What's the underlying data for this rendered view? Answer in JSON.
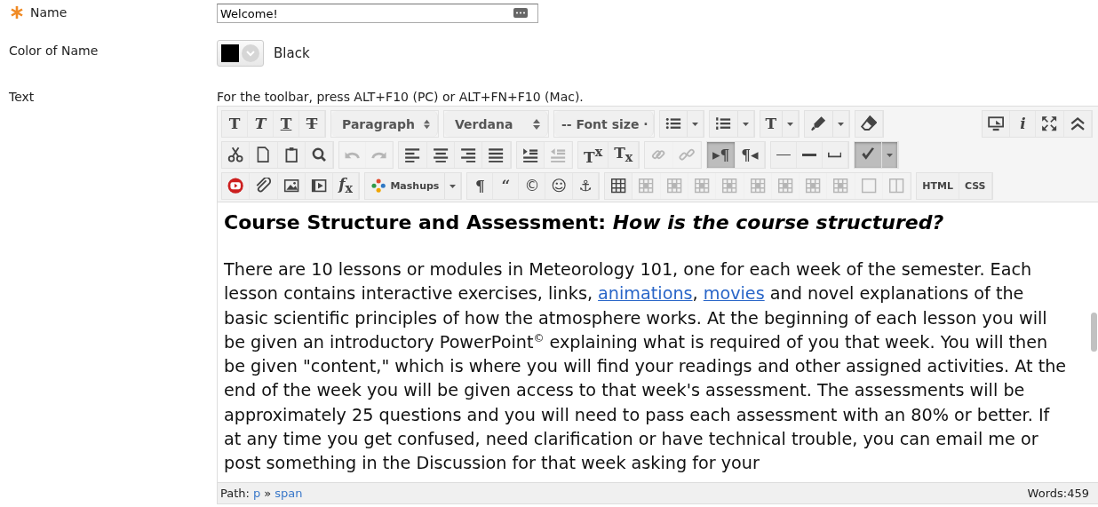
{
  "fields": {
    "name": {
      "label": "Name",
      "required": true,
      "value": "Welcome!"
    },
    "color": {
      "label": "Color of Name",
      "value": "Black"
    },
    "text": {
      "label": "Text",
      "hint": "For the toolbar, press ALT+F10 (PC) or ALT+FN+F10 (Mac)."
    }
  },
  "toolbar": {
    "rows": [
      {
        "groups": [
          {
            "items": [
              {
                "kind": "text",
                "label": "T",
                "disabled": false,
                "pressed": false
              },
              {
                "kind": "text",
                "label": "T",
                "disabled": false,
                "pressed": false
              },
              {
                "kind": "text",
                "label": "T",
                "disabled": false,
                "pressed": false
              },
              {
                "kind": "text",
                "label": "T",
                "disabled": false,
                "pressed": false
              }
            ]
          },
          {
            "items": [
              {
                "kind": "select",
                "label": "Paragraph",
                "disabled": false,
                "pressed": false
              }
            ]
          },
          {
            "items": [
              {
                "kind": "select",
                "label": "Verdana",
                "disabled": false,
                "pressed": false
              }
            ]
          },
          {
            "items": [
              {
                "kind": "select",
                "label": "-- Font size ·",
                "disabled": false,
                "pressed": false
              }
            ]
          },
          {
            "items": [
              {
                "kind": "split",
                "disabled": false,
                "pressed": false
              }
            ]
          },
          {
            "items": [
              {
                "kind": "split",
                "disabled": false,
                "pressed": false
              }
            ]
          },
          {
            "items": [
              {
                "kind": "split",
                "label": "T",
                "disabled": false,
                "pressed": false
              }
            ]
          },
          {
            "items": [
              {
                "kind": "split",
                "disabled": false,
                "pressed": false
              }
            ]
          },
          {
            "items": [
              {
                "kind": "icon",
                "disabled": false,
                "pressed": false
              }
            ]
          }
        ],
        "end_group": {
          "items": [
            {
              "kind": "icon",
              "disabled": false,
              "pressed": false
            },
            {
              "kind": "text",
              "label": "i",
              "disabled": false,
              "pressed": false
            },
            {
              "kind": "icon",
              "disabled": false,
              "pressed": false
            },
            {
              "kind": "icon",
              "disabled": false,
              "pressed": false
            }
          ]
        }
      },
      {
        "groups": [
          {
            "items": [
              {
                "kind": "icon",
                "disabled": false,
                "pressed": false
              },
              {
                "kind": "icon",
                "disabled": false,
                "pressed": false
              },
              {
                "kind": "icon",
                "disabled": false,
                "pressed": false
              },
              {
                "kind": "icon",
                "disabled": false,
                "pressed": false
              }
            ]
          },
          {
            "items": [
              {
                "kind": "icon",
                "disabled": true,
                "pressed": false
              },
              {
                "kind": "icon",
                "disabled": true,
                "pressed": false
              }
            ]
          },
          {
            "items": [
              {
                "kind": "icon",
                "disabled": false,
                "pressed": false
              },
              {
                "kind": "icon",
                "disabled": false,
                "pressed": false
              },
              {
                "kind": "icon",
                "disabled": false,
                "pressed": false
              },
              {
                "kind": "icon",
                "disabled": false,
                "pressed": false
              }
            ]
          },
          {
            "items": [
              {
                "kind": "icon",
                "disabled": false,
                "pressed": false
              },
              {
                "kind": "icon",
                "disabled": true,
                "pressed": false
              }
            ]
          },
          {
            "items": [
              {
                "kind": "text",
                "label": "T$^{x}$",
                "disabled": false,
                "pressed": false
              },
              {
                "kind": "text",
                "label": "T$_{x}$",
                "disabled": false,
                "pressed": false
              }
            ]
          },
          {
            "items": [
              {
                "kind": "icon",
                "disabled": true,
                "pressed": false
              },
              {
                "kind": "icon",
                "disabled": true,
                "pressed": false
              }
            ]
          },
          {
            "items": [
              {
                "kind": "text",
                "label": "▸¶",
                "disabled": false,
                "pressed": true
              },
              {
                "kind": "text",
                "label": "¶◂",
                "disabled": false,
                "pressed": false
              }
            ]
          },
          {
            "items": [
              {
                "kind": "icon",
                "disabled": false,
                "pressed": false
              },
              {
                "kind": "icon",
                "disabled": false,
                "pressed": false
              },
              {
                "kind": "icon",
                "disabled": false,
                "pressed": false
              }
            ]
          },
          {
            "items": [
              {
                "kind": "split",
                "disabled": false,
                "pressed": true
              }
            ]
          }
        ]
      },
      {
        "groups": [
          {
            "items": [
              {
                "kind": "icon",
                "disabled": false,
                "pressed": false
              },
              {
                "kind": "icon",
                "disabled": false,
                "pressed": false
              },
              {
                "kind": "icon",
                "disabled": false,
                "pressed": false
              },
              {
                "kind": "icon",
                "disabled": false,
                "pressed": false
              },
              {
                "kind": "text",
                "label": "*f*$_{x}$",
                "disabled": false,
                "pressed": false
              }
            ]
          },
          {
            "items": [
              {
                "kind": "split",
                "label": "Mashups",
                "disabled": false,
                "pressed": false
              }
            ]
          },
          {
            "items": [
              {
                "kind": "text",
                "label": "¶",
                "disabled": false,
                "pressed": false
              },
              {
                "kind": "text",
                "label": "“",
                "disabled": false,
                "pressed": false
              },
              {
                "kind": "text",
                "label": "©",
                "disabled": false,
                "pressed": false
              },
              {
                "kind": "text",
                "label": "☺",
                "disabled": false,
                "pressed": false
              },
              {
                "kind": "text",
                "label": "⚓",
                "disabled": false,
                "pressed": false
              }
            ]
          },
          {
            "items": [
              {
                "kind": "icon",
                "disabled": false,
                "pressed": false
              },
              {
                "kind": "icon",
                "disabled": true,
                "pressed": false
              },
              {
                "kind": "icon",
                "disabled": true,
                "pressed": false
              },
              {
                "kind": "icon",
                "disabled": true,
                "pressed": false
              },
              {
                "kind": "icon",
                "disabled": true,
                "pressed": false
              },
              {
                "kind": "icon",
                "disabled": true,
                "pressed": false
              },
              {
                "kind": "icon",
                "disabled": true,
                "pressed": false
              },
              {
                "kind": "icon",
                "disabled": true,
                "pressed": false
              },
              {
                "kind": "icon",
                "disabled": true,
                "pressed": false
              },
              {
                "kind": "icon",
                "disabled": true,
                "pressed": false
              },
              {
                "kind": "icon",
                "disabled": true,
                "pressed": false
              }
            ]
          },
          {
            "items": [
              {
                "kind": "text",
                "label": "HTML",
                "disabled": false,
                "pressed": false
              },
              {
                "kind": "text",
                "label": "CSS",
                "disabled": false,
                "pressed": false
              }
            ]
          }
        ]
      }
    ]
  },
  "content": {
    "heading": "Course Structure and Assessment: *How is the course structured?*",
    "paragraph": [
      {
        "kind": "text",
        "text": "There are 10 lessons or modules in Meteorology 101, one for each week of the semester. Each lesson contains interactive exercises, links, "
      },
      {
        "kind": "link",
        "text": "animations"
      },
      {
        "kind": "text",
        "text": ", "
      },
      {
        "kind": "link",
        "text": "movies"
      },
      {
        "kind": "text",
        "text": " and novel explanations of the basic scientific principles of how the atmosphere works. At the beginning of each lesson you will be given an introductory PowerPoint$^{©}$ explaining what is required of you that week. You will then be given \"content,\" which is where you will find your readings and other assigned activities. At the end of the week you will be given access to that week's assessment. The assessments will be approximately 25 questions and you will need to pass each assessment with an 80% or better. If at any time you get confused, need clarification or have technical trouble, you can email me or post something in the Discussion for that week asking for your"
      }
    ]
  },
  "status_bar": {
    "path_label": "Path:",
    "path": [
      {
        "text": "p"
      },
      {
        "text": "span"
      }
    ],
    "separator": "»",
    "word_count": "Words:459"
  }
}
